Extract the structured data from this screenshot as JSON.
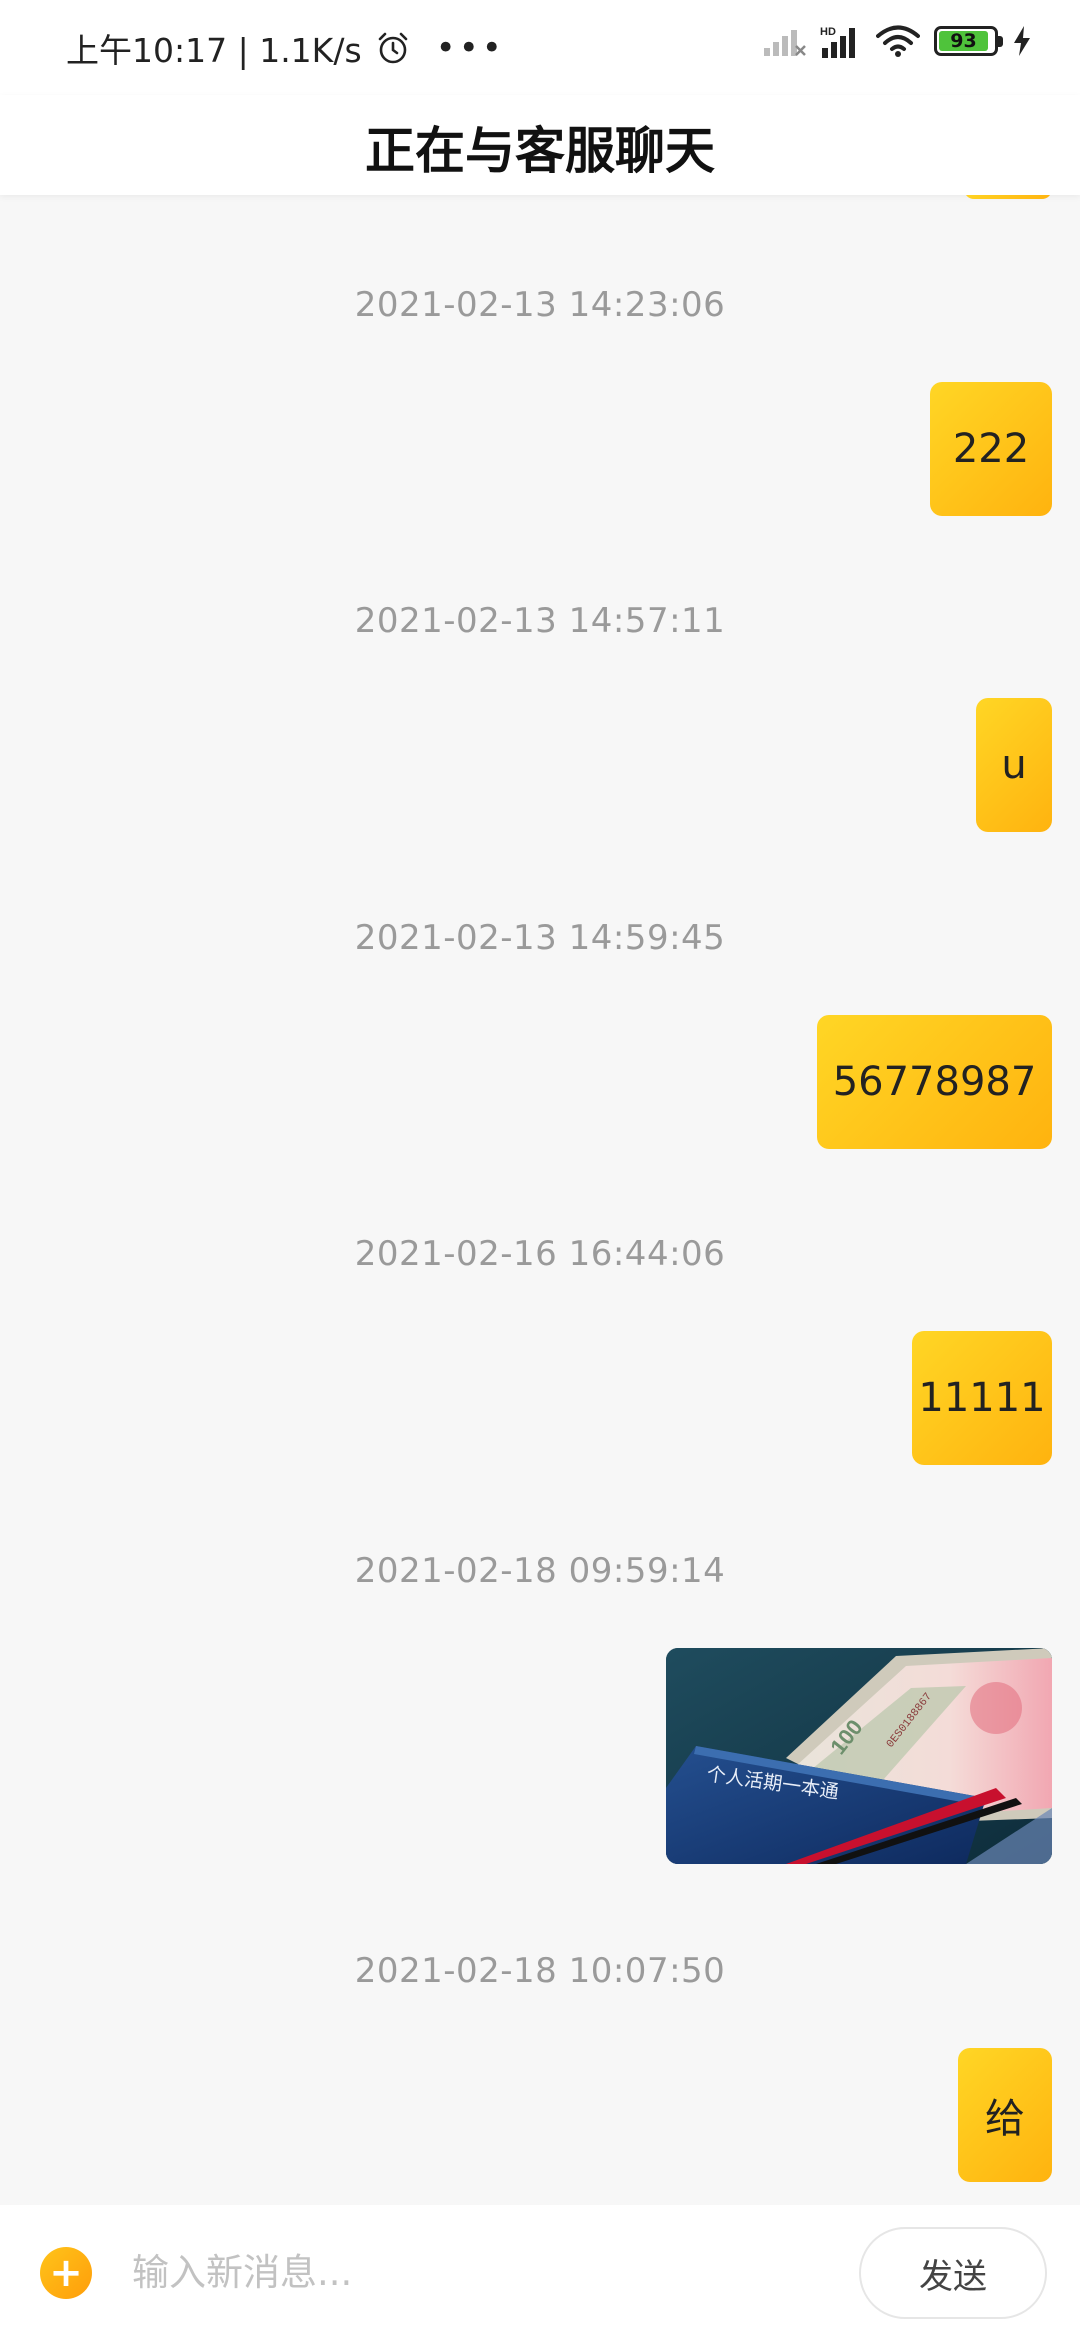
{
  "status_bar": {
    "time_speed": "上午10:17 | 1.1K/s",
    "more": "•••",
    "battery_level": "93",
    "icons": [
      "alarm-icon",
      "signal-icon",
      "hd-signal-icon",
      "wifi-icon",
      "battery-icon",
      "charging-icon"
    ]
  },
  "header": {
    "title": "正在与客服聊天"
  },
  "messages": [
    {
      "timestamp": "2021-02-13 14:23:06",
      "text": "222"
    },
    {
      "timestamp": "2021-02-13 14:57:11",
      "text": "u"
    },
    {
      "timestamp": "2021-02-13 14:59:45",
      "text": "56778987"
    },
    {
      "timestamp": "2021-02-16 16:44:06",
      "text": "11111"
    },
    {
      "timestamp": "2021-02-18 09:59:14",
      "image": "passbook-and-banknotes-photo",
      "image_caption": "个人活期一本通"
    },
    {
      "timestamp": "2021-02-18 10:07:50",
      "text": "给"
    }
  ],
  "input_bar": {
    "placeholder": "输入新消息...",
    "send_label": "发送",
    "plus_icon": "plus-icon"
  },
  "colors": {
    "bubble_start": "#ffd625",
    "bubble_end": "#ffb30f",
    "background": "#f7f7f7",
    "timestamp": "#9a9a9a"
  }
}
